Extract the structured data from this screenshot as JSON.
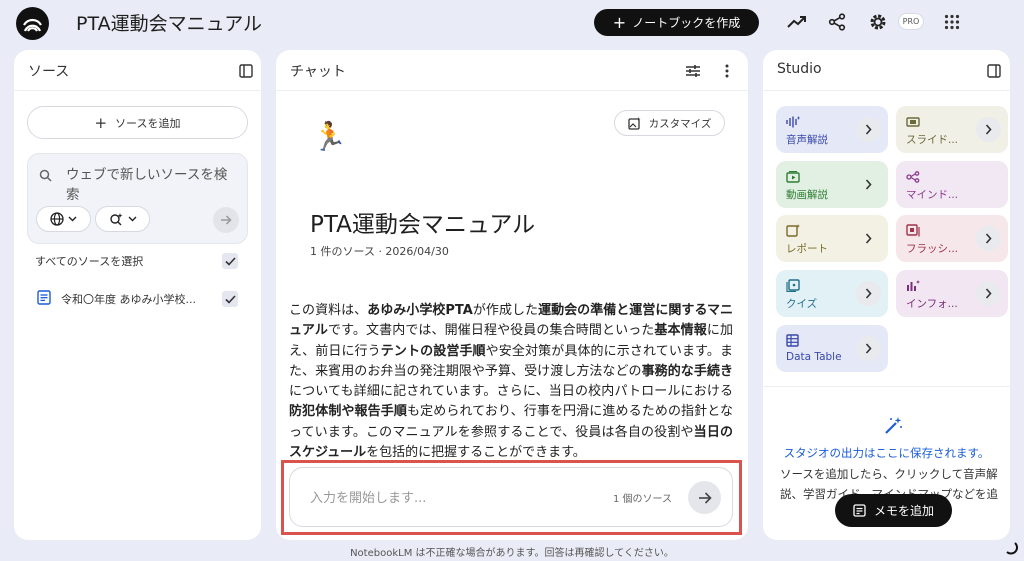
{
  "header": {
    "app_title": "PTA運動会マニュアル",
    "create_label": "ノートブックを作成",
    "pro_label": "PRO"
  },
  "sources": {
    "title": "ソース",
    "add_label": "ソースを追加",
    "search_placeholder": "ウェブで新しいソースを検索",
    "select_all_label": "すべてのソースを選択",
    "items": [
      {
        "label": "令和〇年度 あゆみ小学校...",
        "checked": true
      }
    ]
  },
  "chat": {
    "title": "チャット",
    "customize_label": "カスタマイズ",
    "emoji": "🏃",
    "doc_title": "PTA運動会マニュアル",
    "doc_meta": "1 件のソース · 2026/04/30",
    "summary": {
      "p1": "この資料は、",
      "b1": "あゆみ小学校PTA",
      "p2": "が作成した",
      "b2": "運動会の準備と運営に関するマニュアル",
      "p3": "です。文書内では、開催日程や役員の集合時間といった",
      "b3": "基本情報",
      "p4": "に加え、前日に行う",
      "b4": "テントの設営手順",
      "p5": "や安全対策が具体的に示されています。また、来賓用のお弁当の発注期限や予算、受け渡し方法などの",
      "b5": "事務的な手続き",
      "p6": "についても詳細に記されています。さらに、当日の校内パトロールにおける",
      "b6": "防犯体制や報告手順",
      "p7": "も定められており、行事を円滑に進めるための指針となっています。このマニュアルを参照することで、役員は各自の役割や",
      "b7": "当日のスケジュール",
      "p8": "を包括的に把握することができます。"
    },
    "input_placeholder": "入力を開始します...",
    "source_count": "1 個のソース"
  },
  "studio": {
    "title": "Studio",
    "tiles": [
      {
        "label": "音声解説",
        "icon": "audio-wave-icon",
        "bg": "#e5e8f6",
        "fg": "#3949ab"
      },
      {
        "label": "スライド...",
        "icon": "slides-icon",
        "bg": "#f1f0e6",
        "fg": "#6b6a3a"
      },
      {
        "label": "動画解説",
        "icon": "video-icon",
        "bg": "#e1f0e3",
        "fg": "#2e7d32"
      },
      {
        "label": "マインド...",
        "icon": "mindmap-icon",
        "bg": "#f1e8f3",
        "fg": "#8e3a8e"
      },
      {
        "label": "レポート",
        "icon": "report-icon",
        "bg": "#f3f1e4",
        "fg": "#7a6a2a"
      },
      {
        "label": "フラッシ...",
        "icon": "flashcard-icon",
        "bg": "#f6e7ea",
        "fg": "#a0324a"
      },
      {
        "label": "クイズ",
        "icon": "quiz-icon",
        "bg": "#e2f1f6",
        "fg": "#1f6f8b"
      },
      {
        "label": "インフォ...",
        "icon": "infographic-icon",
        "bg": "#f1e6f1",
        "fg": "#7b2f7b"
      },
      {
        "label": "Data Table",
        "icon": "table-icon",
        "bg": "#e5e8f6",
        "fg": "#3949ab"
      }
    ],
    "headline": "スタジオの出力はここに保存されます。",
    "body_line1": "ソースを追加したら、クリックして音声解",
    "body_line2": "説、学習ガイド、マインドマップなどを追",
    "memo_label": "メモを追加"
  },
  "footer": {
    "note": "NotebookLM は不正確な場合があります。回答は再確認してください。"
  }
}
